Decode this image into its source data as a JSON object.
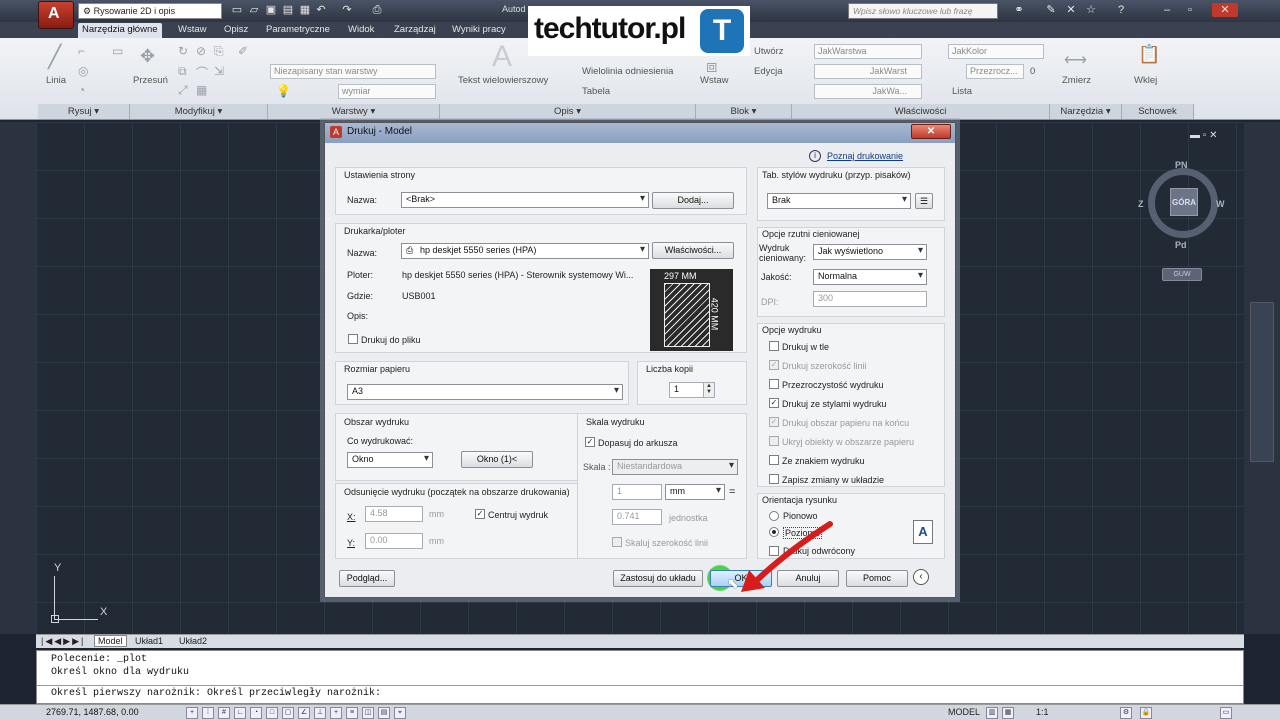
{
  "titlebar": {
    "workspace": "Rysowanie 2D i opis",
    "app_name": "Autod",
    "search_placeholder": "Wpisz słowo kluczowe lub frazę",
    "icons": [
      "new-icon",
      "open-icon",
      "save-icon",
      "saveas-icon",
      "print-icon",
      "undo-icon",
      "redo-icon",
      "plot-icon"
    ]
  },
  "ribbon_tabs": [
    "Narzędzia główne",
    "Wstaw",
    "Opisz",
    "Parametryczne",
    "Widok",
    "Zarządzaj",
    "Wyniki pracy"
  ],
  "ribbon": {
    "linia": "Linia",
    "przesun": "Przesuń",
    "tekst": "Tekst wielowierszowy",
    "wielolinia": "Wielolinia odniesienia",
    "tabela": "Tabela",
    "wstaw": "Wstaw",
    "utworz": "Utwórz",
    "edycja": "Edycja",
    "jakwarstwa": "JakWarstwa",
    "jakkolor": "JakKolor",
    "jakwarst": "JakWarst",
    "jakwa": "JakWa...",
    "przezrocz": "Przezrocz...",
    "przezrocz_val": "0",
    "lista": "Lista",
    "zmierz": "Zmierz",
    "wklej": "Wklej",
    "layer_state": "Niezapisany stan warstwy",
    "layer_name": "wymiar",
    "panels": [
      "Rysuj ▾",
      "Modyfikuj ▾",
      "Warstwy ▾",
      "Opis ▾",
      "Blok ▾",
      "Właściwości",
      "Narzędzia ▾",
      "Schowek"
    ]
  },
  "logo": {
    "text": "techtutor.pl",
    "badge": "T"
  },
  "viewcube": {
    "n": "PN",
    "s": "Pd",
    "e": "W",
    "w": "Z",
    "face": "GÓRA",
    "wcs": "GUW"
  },
  "layout_tabs": [
    "Model",
    "Układ1",
    "Układ2"
  ],
  "command": {
    "lines": [
      "Polecenie: _plot",
      "Określ okno dla wydruku",
      "Określ pierwszy narożnik: Określ przeciwległy narożnik:"
    ]
  },
  "status": {
    "coords": "2769.71, 1487.68, 0.00",
    "model": "MODEL",
    "scale": "1:1"
  },
  "dialog": {
    "title": "Drukuj - Model",
    "help_link": "Poznaj drukowanie",
    "page_setup": {
      "title": "Ustawienia strony",
      "name_label": "Nazwa:",
      "name_value": "<Brak>",
      "add_button": "Dodaj..."
    },
    "printer": {
      "title": "Drukarka/ploter",
      "name_label": "Nazwa:",
      "name_value": "hp deskjet 5550 series (HPA)",
      "properties_button": "Właściwości...",
      "plotter_label": "Ploter:",
      "plotter_value": "hp deskjet 5550 series (HPA) - Sterownik systemowy Wi...",
      "where_label": "Gdzie:",
      "where_value": "USB001",
      "desc_label": "Opis:",
      "to_file_label": "Drukuj do pliku",
      "preview_width": "297 MM",
      "preview_height": "420 MM"
    },
    "paper": {
      "title": "Rozmiar papieru",
      "value": "A3"
    },
    "copies": {
      "title": "Liczba kopii",
      "value": "1"
    },
    "area": {
      "title": "Obszar wydruku",
      "what_label": "Co wydrukować:",
      "what_value": "Okno",
      "window_button": "Okno (1)<"
    },
    "offset": {
      "title": "Odsunięcie wydruku (początek na obszarze drukowania)",
      "x_label": "X:",
      "x_value": "4.58",
      "y_label": "Y:",
      "y_value": "0.00",
      "unit": "mm",
      "center_label": "Centruj wydruk"
    },
    "scale": {
      "title": "Skala wydruku",
      "fit_label": "Dopasuj do arkusza",
      "scale_label": "Skala :",
      "scale_value": "Niestandardowa",
      "val1": "1",
      "unit1": "mm",
      "equals": "=",
      "val2": "0.741",
      "unit2": "jednostka",
      "lineweights_label": "Skaluj szerokość linii"
    },
    "style_table": {
      "title": "Tab. stylów wydruku (przyp. pisaków)",
      "value": "Brak"
    },
    "shaded": {
      "title": "Opcje rzutni cieniowanej",
      "shaded_label": "Wydruk cieniowany:",
      "shaded_value": "Jak wyświetlono",
      "quality_label": "Jakość:",
      "quality_value": "Normalna",
      "dpi_label": "DPI:",
      "dpi_value": "300"
    },
    "options": {
      "title": "Opcje wydruku",
      "items": [
        {
          "label": "Drukuj w tle",
          "checked": "",
          "disabled": false
        },
        {
          "label": "Drukuj szerokość linii",
          "checked": "✓",
          "disabled": true
        },
        {
          "label": "Przezroczystość wydruku",
          "checked": "",
          "disabled": false
        },
        {
          "label": "Drukuj ze stylami wydruku",
          "checked": "✓",
          "disabled": false
        },
        {
          "label": "Drukuj obszar papieru na końcu",
          "checked": "✓",
          "disabled": true
        },
        {
          "label": "Ukryj obiekty w obszarze papieru",
          "checked": "",
          "disabled": true
        },
        {
          "label": "Ze znakiem wydruku",
          "checked": "",
          "disabled": false
        },
        {
          "label": "Zapisz zmiany w układzie",
          "checked": "",
          "disabled": false
        }
      ]
    },
    "orientation": {
      "title": "Orientacja rysunku",
      "portrait": "Pionowo",
      "landscape": "Poziomo",
      "reverse": "Drukuj odwrócony",
      "icon_letter": "A"
    },
    "buttons": {
      "preview": "Podgląd...",
      "apply": "Zastosuj do układu",
      "ok": "OK",
      "cancel": "Anuluj",
      "help": "Pomoc"
    }
  }
}
